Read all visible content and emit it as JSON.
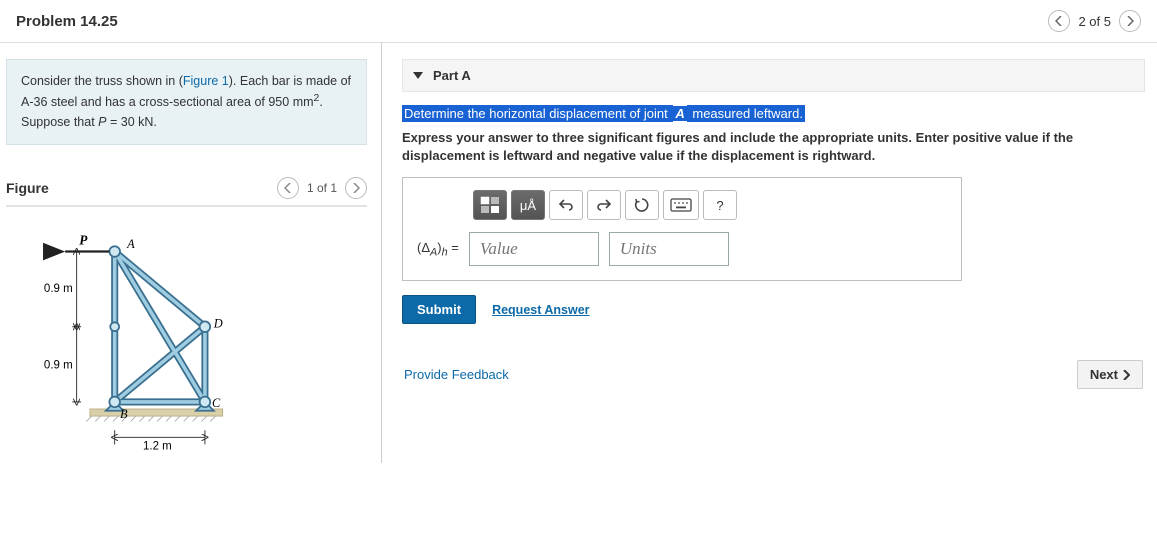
{
  "header": {
    "title": "Problem 14.25",
    "pager_text": "2 of 5"
  },
  "prompt": {
    "pre": "Consider the truss shown in (",
    "fig_link": "Figure 1",
    "post1": "). Each bar is made of A-36 steel and has a cross-sectional area of ",
    "area_val": "950 mm",
    "area_exp": "2",
    "post2": ". Suppose that ",
    "P_var": "P",
    "P_eq": " = 30 kN",
    "tail": "."
  },
  "figure": {
    "heading": "Figure",
    "pager_text": "1 of 1",
    "labels": {
      "P": "P",
      "A": "A",
      "B": "B",
      "C": "C",
      "D": "D",
      "d09a": "0.9 m",
      "d09b": "0.9 m",
      "d12": "1.2 m"
    }
  },
  "part": {
    "label": "Part A",
    "instr_hl_full": "Determine the horizontal displacement of joint ",
    "instr_hl_A": "A",
    "instr_hl_tail": " measured leftward.",
    "instr2": "Express your answer to three significant figures and include the appropriate units. Enter positive value if the displacement is leftward and negative value if the displacement is rightward.",
    "toolbar": {
      "templates": "templates-icon",
      "units": "μÅ",
      "undo": "undo-icon",
      "redo": "redo-icon",
      "reset": "reset-icon",
      "keyboard": "keyboard-icon",
      "help": "?"
    },
    "lhs_text": "(Δ_A)_h =",
    "value_placeholder": "Value",
    "units_placeholder": "Units",
    "submit_label": "Submit",
    "request_label": "Request Answer"
  },
  "footer": {
    "feedback": "Provide Feedback",
    "next": "Next"
  }
}
